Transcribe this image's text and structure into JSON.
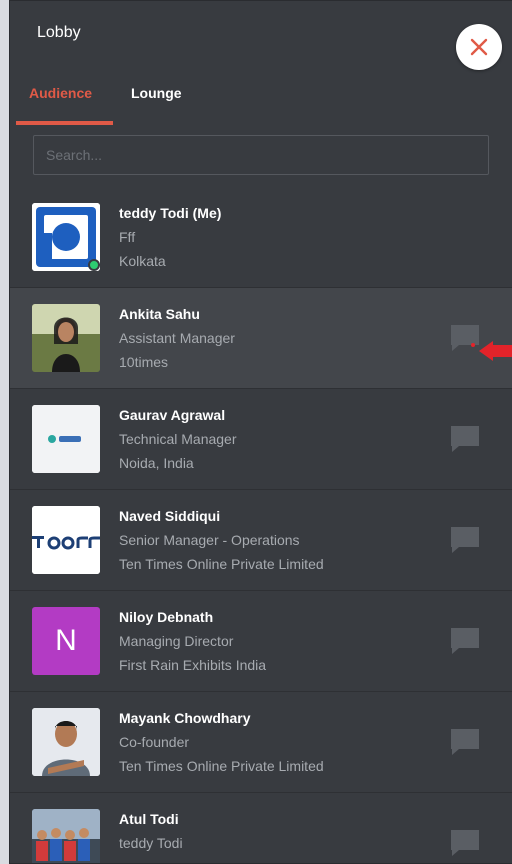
{
  "header": {
    "title": "Lobby"
  },
  "tabs": [
    {
      "label": "Audience",
      "active": true
    },
    {
      "label": "Lounge",
      "active": false
    }
  ],
  "search": {
    "placeholder": "Search...",
    "value": ""
  },
  "attendees": [
    {
      "name": "teddy Todi (Me)",
      "line1": "Fff",
      "line2": "Kolkata",
      "avatar": "logo-blue-square",
      "online": true,
      "chat": false
    },
    {
      "name": "Ankita Sahu",
      "line1": "Assistant Manager",
      "line2": "10times",
      "avatar": "photo",
      "online": false,
      "chat": true
    },
    {
      "name": "Gaurav Agrawal",
      "line1": "Technical Manager",
      "line2": "Noida, India",
      "avatar": "company-logo",
      "online": false,
      "chat": true
    },
    {
      "name": "Naved Siddiqui",
      "line1": "Senior Manager - Operations",
      "line2": "Ten Times Online Private Limited",
      "avatar": "floor-logo",
      "online": false,
      "chat": true
    },
    {
      "name": "Niloy Debnath",
      "line1": "Managing Director",
      "line2": "First Rain Exhibits India",
      "avatar": "letter",
      "avatar_letter": "N",
      "avatar_color": "#b33bc4",
      "online": false,
      "chat": true
    },
    {
      "name": "Mayank Chowdhary",
      "line1": "Co-founder",
      "line2": "Ten Times Online Private Limited",
      "avatar": "photo",
      "online": false,
      "chat": true
    },
    {
      "name": "Atul Todi",
      "line1": "teddy Todi",
      "line2": "",
      "avatar": "group-photo",
      "online": false,
      "chat": true
    }
  ],
  "colors": {
    "accent": "#e05a47",
    "panel": "#383b40",
    "pointer": "#e3232a"
  }
}
